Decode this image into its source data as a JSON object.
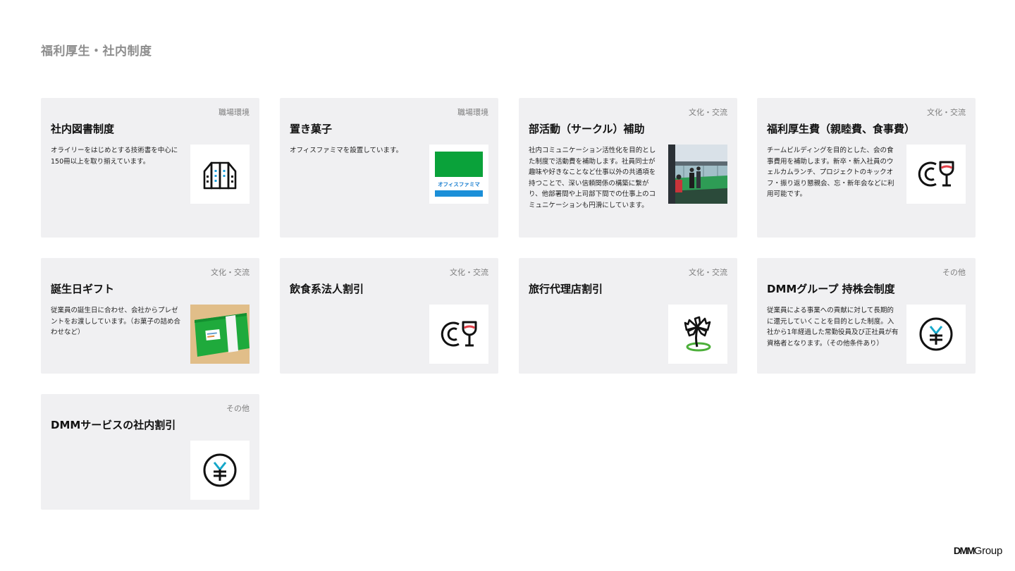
{
  "page": {
    "title": "福利厚生・社内制度"
  },
  "cards": [
    {
      "tag": "職場環境",
      "title": "社内図書制度",
      "desc": "オライリーをはじめとする技術書を中心に150冊以上を取り揃えています。",
      "icon": "bookshelf-icon"
    },
    {
      "tag": "職場環境",
      "title": "置き菓子",
      "desc": "オフィスファミマを設置しています。",
      "icon": "office-famima-logo",
      "logo_text": "オフィスファミマ"
    },
    {
      "tag": "文化・交流",
      "title": "部活動（サークル）補助",
      "desc": "社内コミュニケーション活性化を目的とした制度で活動費を補助します。社員同士が趣味や好きなことなど仕事以外の共通項を持つことで、深い信頼関係の構築に繋がり、他部署間や上司部下間での仕事上のコミュニケーションも円滑にしています。",
      "icon": "golf-range-photo"
    },
    {
      "tag": "文化・交流",
      "title": "福利厚生費（親睦費、食事費）",
      "desc": "チームビルディングを目的とした、会の食事費用を補助します。新卒・新入社員のウェルカムランチ、プロジェクトのキックオフ・振り返り懇親会、忘・新年会などに利用可能です。",
      "icon": "dining-icon"
    },
    {
      "tag": "文化・交流",
      "title": "誕生日ギフト",
      "desc": "従業員の誕生日に合わせ、会社からプレゼントをお渡ししています。（お菓子の詰め合わせなど）",
      "icon": "gift-box-photo"
    },
    {
      "tag": "文化・交流",
      "title": "飲食系法人割引",
      "desc": "",
      "icon": "dining-icon"
    },
    {
      "tag": "文化・交流",
      "title": "旅行代理店割引",
      "desc": "",
      "icon": "palm-tree-icon"
    },
    {
      "tag": "その他",
      "title": "DMMグループ 持株会制度",
      "desc": "従業員による事業への貢献に対して長期的に還元していくことを目的とした制度。入社から1年経過した常勤役員及び正社員が有資格者となります。（その他条件あり）",
      "icon": "yen-icon"
    },
    {
      "tag": "その他",
      "title": "DMMサービスの社内割引",
      "desc": "",
      "icon": "yen-icon"
    }
  ],
  "footer": {
    "logo_dmm": "DMM",
    "logo_group": "Group"
  }
}
